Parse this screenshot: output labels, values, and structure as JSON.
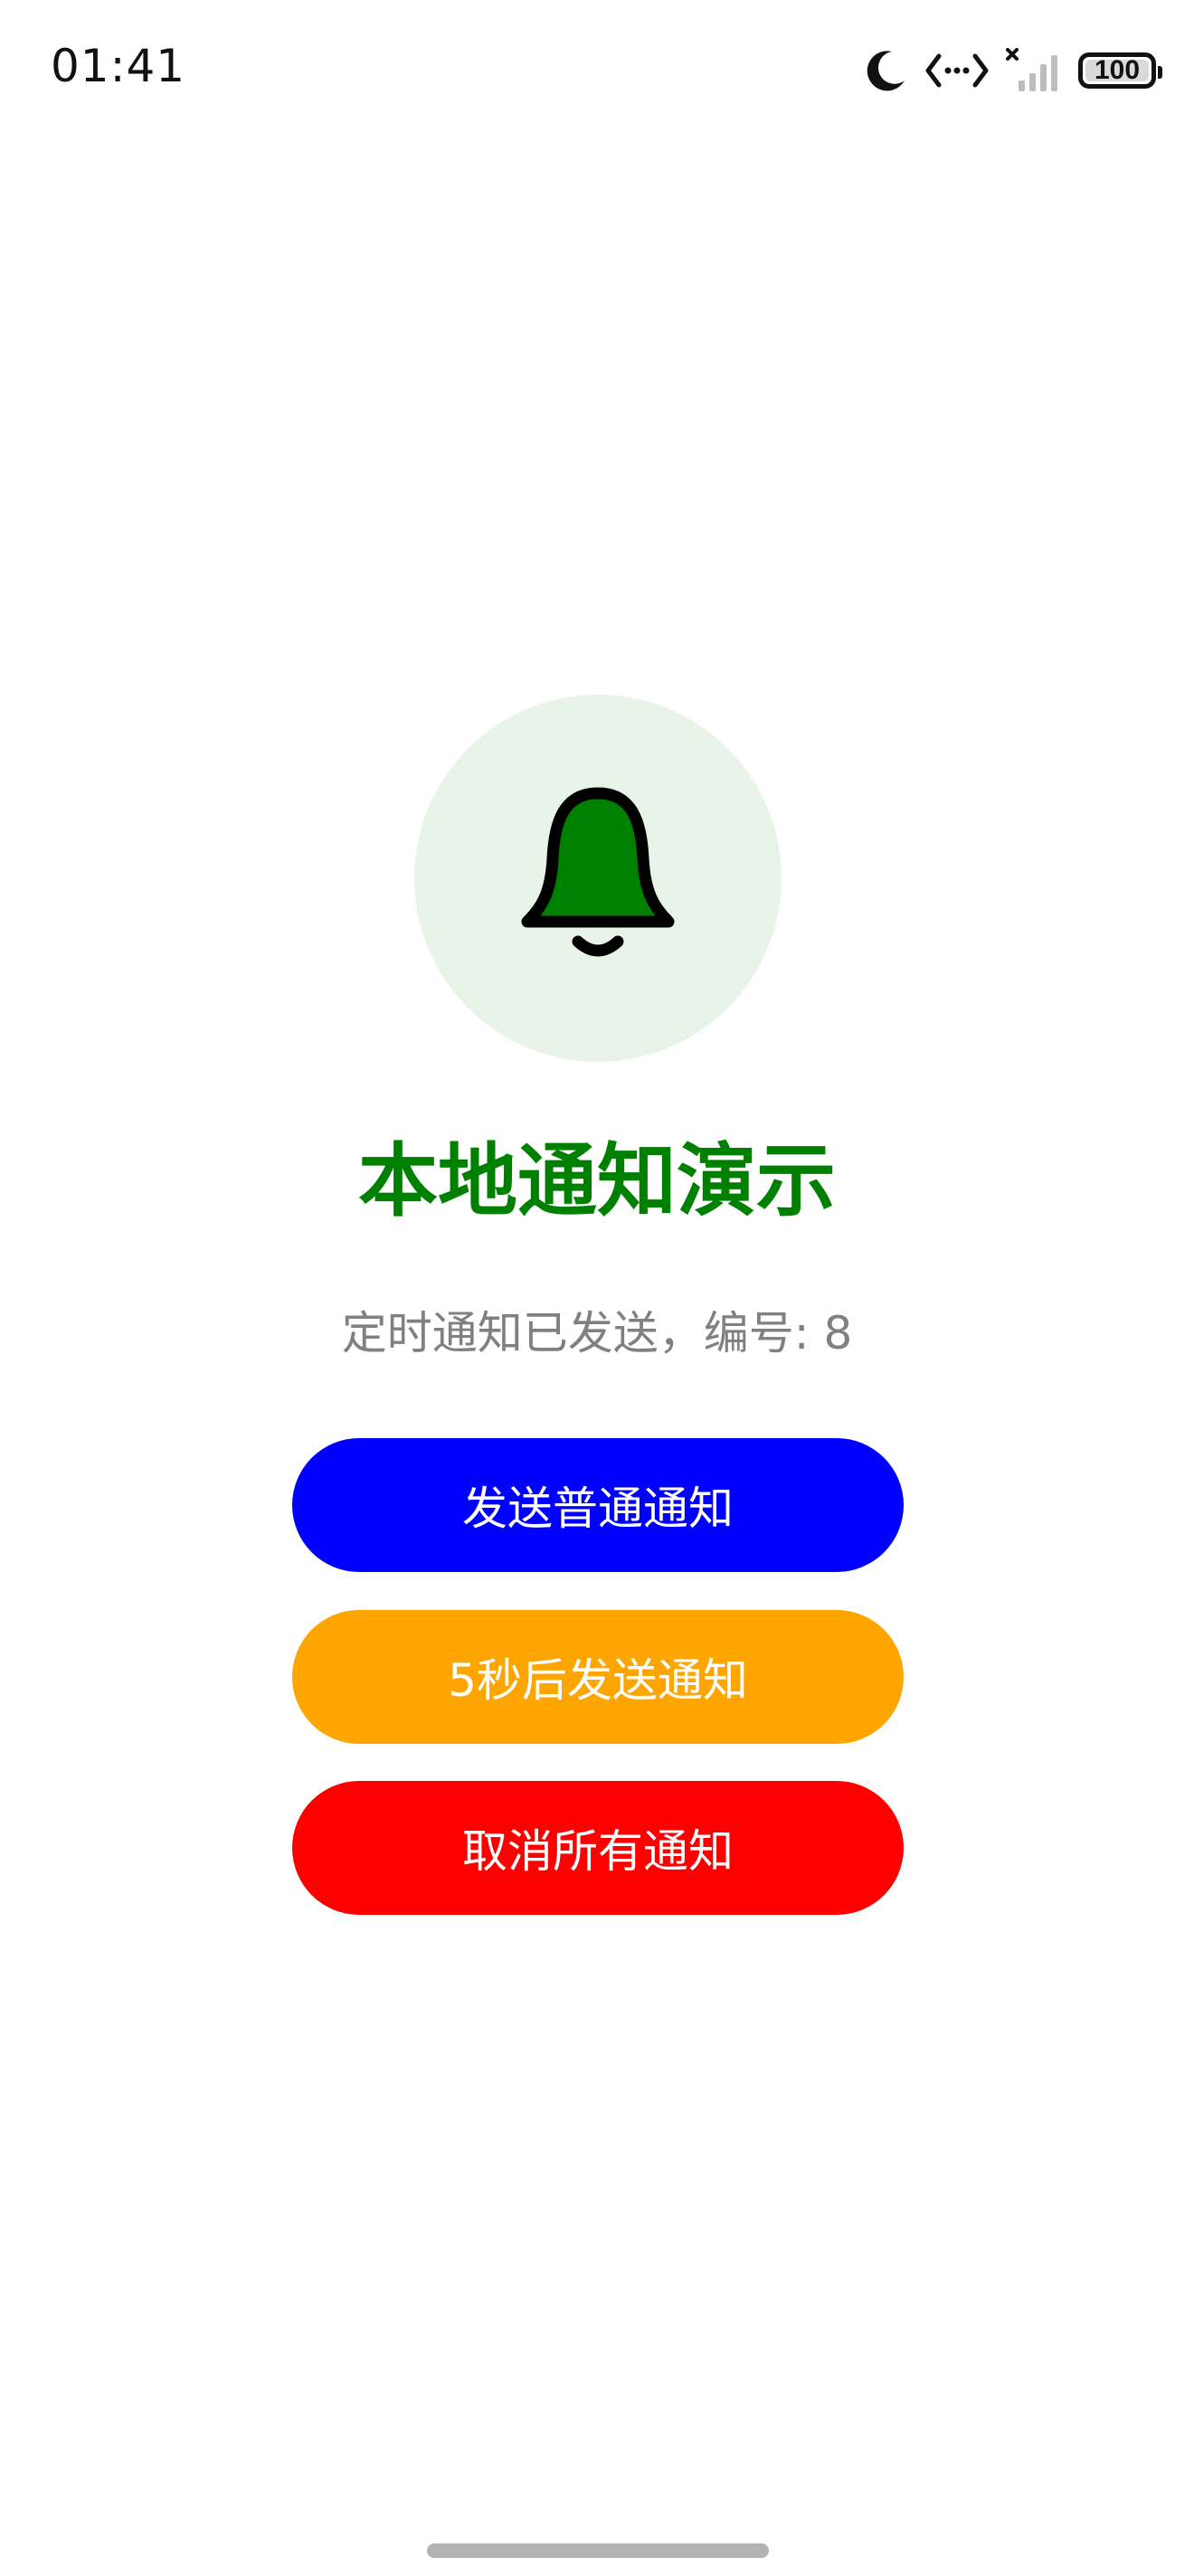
{
  "status_bar": {
    "time": "01:41",
    "battery": "100",
    "icons": [
      "moon-icon",
      "data-transfer-icon",
      "signal-icon",
      "battery-icon"
    ]
  },
  "main": {
    "title": "本地通知演示",
    "status_message": "定时通知已发送，编号: 8",
    "bell_icon": "bell-icon",
    "buttons": {
      "send": "发送普通通知",
      "scheduled": "5秒后发送通知",
      "cancel": "取消所有通知"
    }
  },
  "colors": {
    "title": "#008000",
    "bell_fill": "#008000",
    "bell_circle_bg": "#e8f4e8",
    "status_text": "#808080",
    "send_button": "#0000ff",
    "scheduled_button": "#ffa500",
    "cancel_button": "#ff0000",
    "button_text": "#ffffff"
  }
}
